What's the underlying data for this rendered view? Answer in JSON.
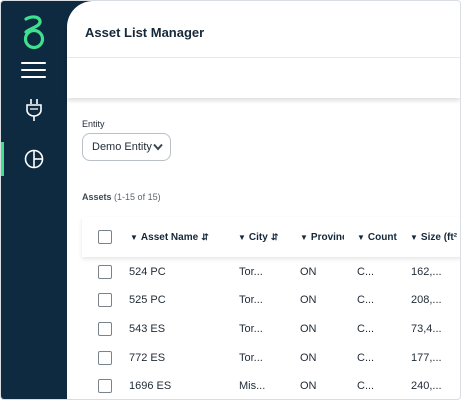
{
  "app": {
    "title": "Asset List Manager"
  },
  "sidebar": {
    "logo": "logo-icon",
    "items": [
      {
        "icon": "plug-icon",
        "active": false
      },
      {
        "icon": "pie-chart-icon",
        "active": true
      }
    ]
  },
  "entity": {
    "label": "Entity",
    "value": "Demo Entity"
  },
  "assets": {
    "label": "Assets",
    "count": "(1-15 of 15)"
  },
  "table": {
    "columns": [
      {
        "label": "Asset Name",
        "filter": true,
        "sort": true
      },
      {
        "label": "City",
        "filter": true,
        "sort": true
      },
      {
        "label": "Provinc",
        "filter": true,
        "sort": false
      },
      {
        "label": "Count",
        "filter": true,
        "sort": false
      },
      {
        "label": "Size (ft²",
        "filter": true,
        "sort": false
      }
    ],
    "rows": [
      [
        "524 PC",
        "Tor...",
        "ON",
        "C...",
        "162,..."
      ],
      [
        "525 PC",
        "Tor...",
        "ON",
        "C...",
        "208,..."
      ],
      [
        "543 ES",
        "Tor...",
        "ON",
        "C...",
        "73,4..."
      ],
      [
        "772 ES",
        "Tor...",
        "ON",
        "C...",
        "177,..."
      ],
      [
        "1696 ES",
        "Mis...",
        "ON",
        "C...",
        "240,..."
      ]
    ]
  },
  "colors": {
    "sidebar": "#0e2a40",
    "accent": "#3fe08f"
  }
}
